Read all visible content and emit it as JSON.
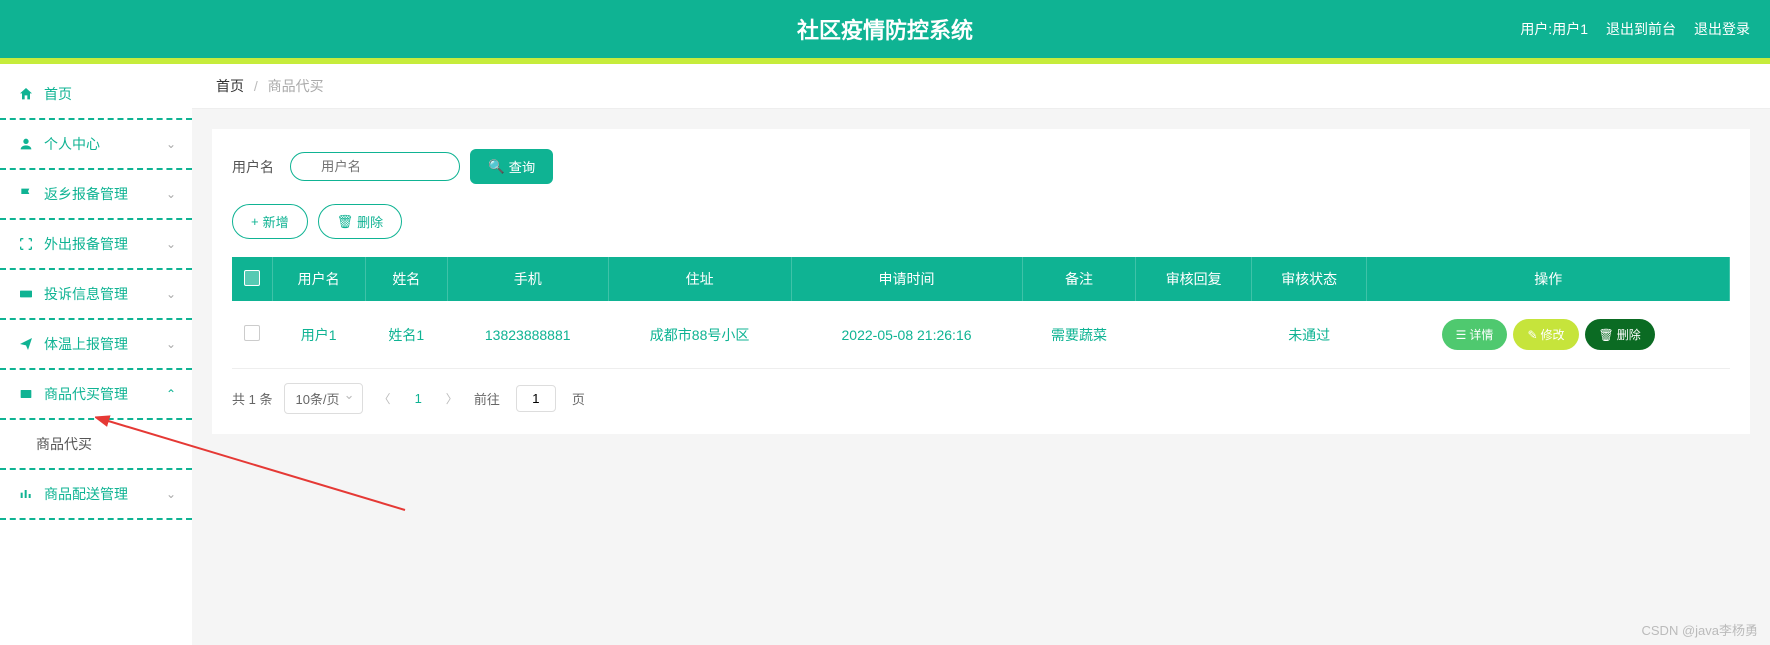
{
  "header": {
    "title": "社区疫情防控系统",
    "user_label": "用户:用户1",
    "back_front": "退出到前台",
    "logout": "退出登录"
  },
  "sidebar": {
    "items": [
      {
        "icon": "home",
        "label": "首页",
        "expandable": false
      },
      {
        "icon": "person",
        "label": "个人中心",
        "expandable": true,
        "open": false
      },
      {
        "icon": "flag",
        "label": "返乡报备管理",
        "expandable": true,
        "open": false
      },
      {
        "icon": "scan",
        "label": "外出报备管理",
        "expandable": true,
        "open": false
      },
      {
        "icon": "ticket",
        "label": "投诉信息管理",
        "expandable": true,
        "open": false
      },
      {
        "icon": "send",
        "label": "体温上报管理",
        "expandable": true,
        "open": false
      },
      {
        "icon": "cart",
        "label": "商品代买管理",
        "expandable": true,
        "open": true
      },
      {
        "icon": "chart",
        "label": "商品配送管理",
        "expandable": true,
        "open": false
      }
    ],
    "submenu_label": "商品代买"
  },
  "breadcrumb": {
    "home": "首页",
    "current": "商品代买"
  },
  "search": {
    "label": "用户名",
    "placeholder": "用户名",
    "button": "查询"
  },
  "actions": {
    "add": "新增",
    "delete": "删除"
  },
  "table": {
    "headers": [
      "用户名",
      "姓名",
      "手机",
      "住址",
      "申请时间",
      "备注",
      "审核回复",
      "审核状态",
      "操作"
    ],
    "rows": [
      {
        "username": "用户1",
        "name": "姓名1",
        "phone": "13823888881",
        "address": "成都市88号小区",
        "apply_time": "2022-05-08 21:26:16",
        "remark": "需要蔬菜",
        "review_reply": "",
        "review_status": "未通过"
      }
    ],
    "ops": {
      "detail": "详情",
      "edit": "修改",
      "delete": "删除"
    }
  },
  "pagination": {
    "total": "共 1 条",
    "page_size": "10条/页",
    "current_page": "1",
    "goto_prefix": "前往",
    "goto_value": "1",
    "goto_suffix": "页"
  },
  "watermark": "CSDN @java李杨勇"
}
